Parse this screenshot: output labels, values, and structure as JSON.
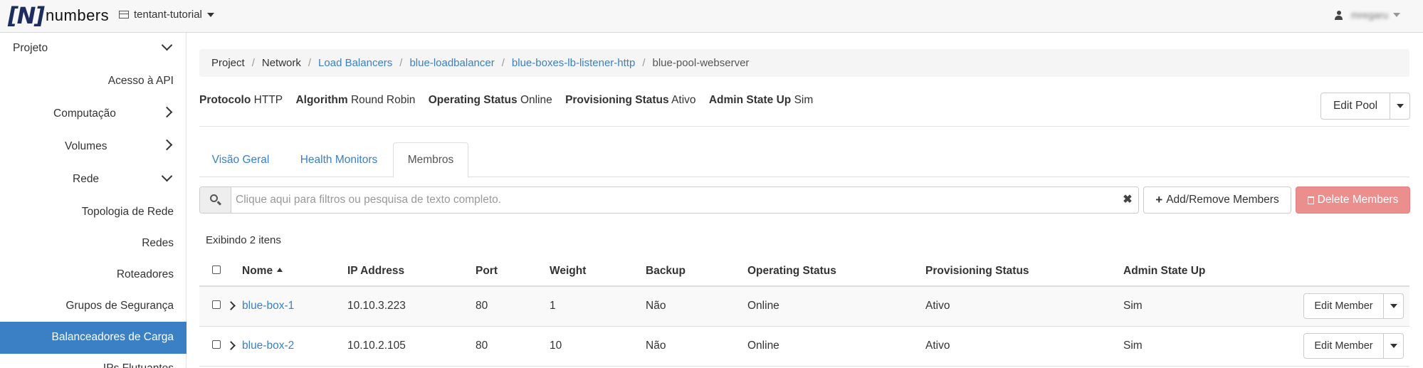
{
  "header": {
    "logo_bracket": "[N]",
    "logo_word": "numbers",
    "project_name": "tentant-tutorial",
    "user_name": "mregaru"
  },
  "sidebar": {
    "items": [
      {
        "label": "Projeto"
      },
      {
        "label": "Acesso à API"
      },
      {
        "label": "Computação"
      },
      {
        "label": "Volumes"
      },
      {
        "label": "Rede"
      },
      {
        "label": "Topologia de Rede"
      },
      {
        "label": "Redes"
      },
      {
        "label": "Roteadores"
      },
      {
        "label": "Grupos de Segurança"
      },
      {
        "label": "Balanceadores de Carga"
      },
      {
        "label": "IPs Flutuantes"
      }
    ]
  },
  "breadcrumb": {
    "items": [
      "Project",
      "Network",
      "Load Balancers",
      "blue-loadbalancer",
      "blue-boxes-lb-listener-http",
      "blue-pool-webserver"
    ]
  },
  "pool": {
    "protocol_label": "Protocolo",
    "protocol_value": "HTTP",
    "algorithm_label": "Algorithm",
    "algorithm_value": "Round Robin",
    "operating_label": "Operating Status",
    "operating_value": "Online",
    "provisioning_label": "Provisioning Status",
    "provisioning_value": "Ativo",
    "admin_label": "Admin State Up",
    "admin_value": "Sim",
    "edit_label": "Edit Pool"
  },
  "tabs": [
    {
      "label": "Visão Geral"
    },
    {
      "label": "Health Monitors"
    },
    {
      "label": "Membros"
    }
  ],
  "search": {
    "placeholder": "Clique aqui para filtros ou pesquisa de texto completo.",
    "value": ""
  },
  "actions": {
    "add_label": "Add/Remove Members",
    "delete_label": "Delete Members"
  },
  "table": {
    "count_text": "Exibindo 2 itens",
    "columns": [
      "Nome",
      "IP Address",
      "Port",
      "Weight",
      "Backup",
      "Operating Status",
      "Provisioning Status",
      "Admin State Up"
    ],
    "rows": [
      {
        "name": "blue-box-1",
        "ip": "10.10.3.223",
        "port": "80",
        "weight": "1",
        "backup": "Não",
        "operating": "Online",
        "provisioning": "Ativo",
        "admin": "Sim",
        "action": "Edit Member"
      },
      {
        "name": "blue-box-2",
        "ip": "10.10.2.105",
        "port": "80",
        "weight": "10",
        "backup": "Não",
        "operating": "Online",
        "provisioning": "Ativo",
        "admin": "Sim",
        "action": "Edit Member"
      }
    ]
  },
  "colors": {
    "accent": "#3b7fc4",
    "danger": "#eb8e8e",
    "active_sidebar": "#3b7fc4"
  }
}
